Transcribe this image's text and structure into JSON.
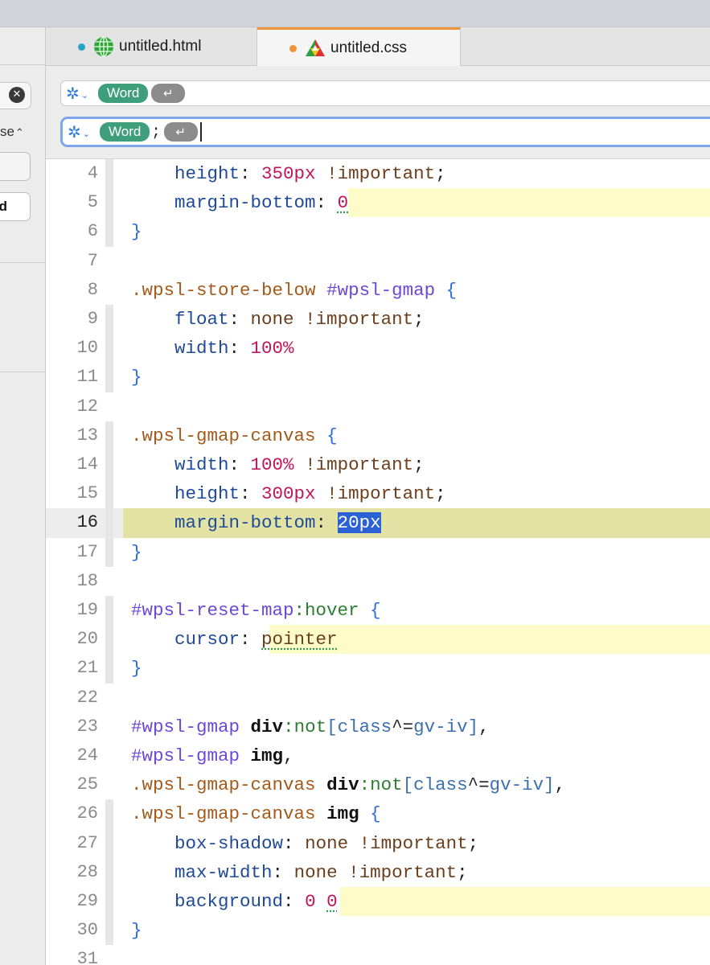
{
  "tabs": [
    {
      "label": "untitled.html",
      "dot_color": "#25a3c8",
      "icon": "globe-icon"
    },
    {
      "label": "untitled.css",
      "dot_color": "#f0943c",
      "icon": "triangle-color-icon"
    }
  ],
  "find": {
    "options_icon": "asterisk-options-icon",
    "token_word": "Word",
    "token_return": "↵"
  },
  "replace": {
    "options_icon": "asterisk-options-icon",
    "token_word": "Word",
    "separator": ";",
    "token_return": "↵"
  },
  "sidebar": {
    "clear_icon": "close-circle-icon",
    "case_label": "se",
    "button2_label": "d"
  },
  "editor": {
    "current_line": 16,
    "selected_text": "20px",
    "lines": [
      {
        "n": "4",
        "text": "    height: 350px !important;"
      },
      {
        "n": "5",
        "text": "    margin-bottom: 0"
      },
      {
        "n": "6",
        "text": "}"
      },
      {
        "n": "7",
        "text": ""
      },
      {
        "n": "8",
        "text": ".wpsl-store-below #wpsl-gmap {"
      },
      {
        "n": "9",
        "text": "    float: none !important;"
      },
      {
        "n": "10",
        "text": "    width: 100%"
      },
      {
        "n": "11",
        "text": "}"
      },
      {
        "n": "12",
        "text": ""
      },
      {
        "n": "13",
        "text": ".wpsl-gmap-canvas {"
      },
      {
        "n": "14",
        "text": "    width: 100% !important;"
      },
      {
        "n": "15",
        "text": "    height: 300px !important;"
      },
      {
        "n": "16",
        "text": "    margin-bottom: 20px"
      },
      {
        "n": "17",
        "text": "}"
      },
      {
        "n": "18",
        "text": ""
      },
      {
        "n": "19",
        "text": "#wpsl-reset-map:hover {"
      },
      {
        "n": "20",
        "text": "    cursor: pointer"
      },
      {
        "n": "21",
        "text": "}"
      },
      {
        "n": "22",
        "text": ""
      },
      {
        "n": "23",
        "text": "#wpsl-gmap div:not[class^=gv-iv],"
      },
      {
        "n": "24",
        "text": "#wpsl-gmap img,"
      },
      {
        "n": "25",
        "text": ".wpsl-gmap-canvas div:not[class^=gv-iv],"
      },
      {
        "n": "26",
        "text": ".wpsl-gmap-canvas img {"
      },
      {
        "n": "27",
        "text": "    box-shadow: none !important;"
      },
      {
        "n": "28",
        "text": "    max-width: none !important;"
      },
      {
        "n": "29",
        "text": "    background: 0 0"
      },
      {
        "n": "30",
        "text": "}"
      },
      {
        "n": "31",
        "text": ""
      }
    ]
  }
}
